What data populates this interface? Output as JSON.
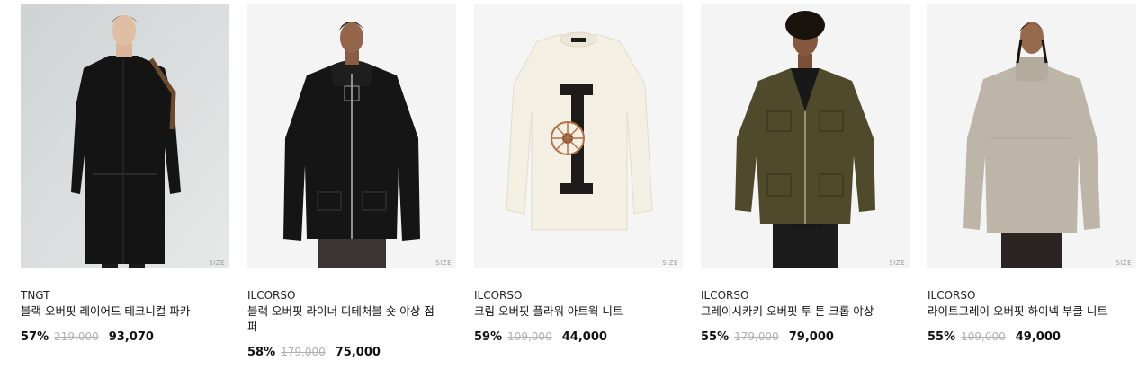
{
  "products": [
    {
      "brand": "TNGT",
      "title": "블랙 오버핏 레이어드 테크니컬 파카",
      "discount": "57%",
      "original_price": "219,000",
      "sale_price": "93,070",
      "size_label": "SIZE",
      "image": "model-black-layered-parka"
    },
    {
      "brand": "ILCORSO",
      "title": "블랙 오버핏 라이너 디테처블 숏 야상 점퍼",
      "discount": "58%",
      "original_price": "179,000",
      "sale_price": "75,000",
      "size_label": "SIZE",
      "image": "model-black-hooded-field-jacket"
    },
    {
      "brand": "ILCORSO",
      "title": "크림 오버핏 플라워 아트웍 니트",
      "discount": "59%",
      "original_price": "109,000",
      "sale_price": "44,000",
      "size_label": "SIZE",
      "image": "cream-flower-artwork-knit-flat"
    },
    {
      "brand": "ILCORSO",
      "title": "그레이시카키 오버핏 투 톤 크롭 야상",
      "discount": "55%",
      "original_price": "179,000",
      "sale_price": "79,000",
      "size_label": "SIZE",
      "image": "model-khaki-cropped-field-jacket"
    },
    {
      "brand": "ILCORSO",
      "title": "라이트그레이 오버핏 하이넥 부클 니트",
      "discount": "55%",
      "original_price": "109,000",
      "sale_price": "49,000",
      "size_label": "SIZE",
      "image": "model-lightgray-highneck-boucle-knit"
    }
  ]
}
